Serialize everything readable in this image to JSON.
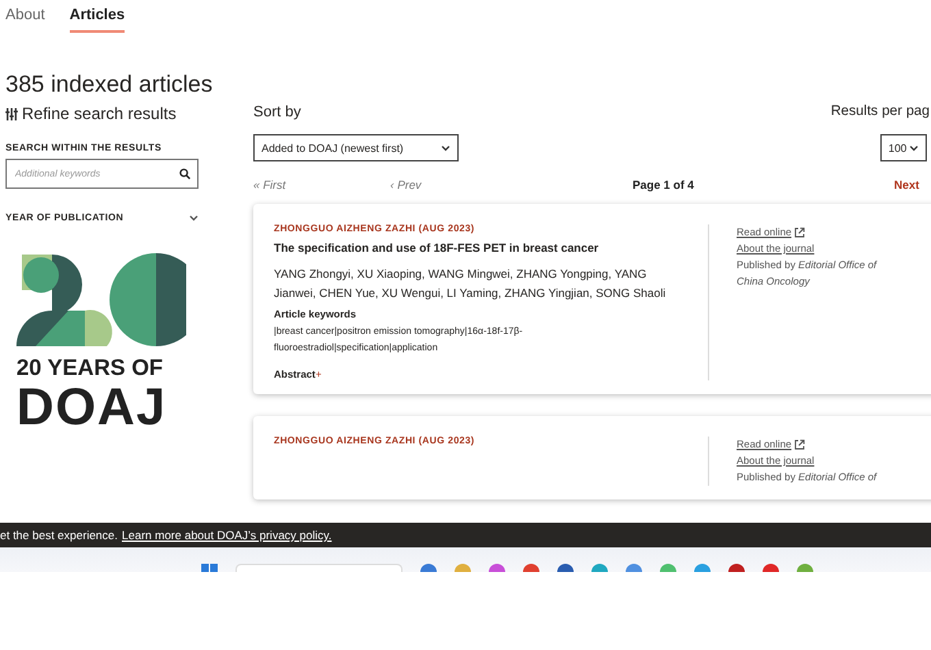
{
  "tabs": [
    {
      "label": "About",
      "selected": false
    },
    {
      "label": "Articles",
      "selected": true
    }
  ],
  "heading": "385 indexed articles",
  "refine": "Refine search results",
  "search": {
    "label": "SEARCH WITHIN THE RESULTS",
    "placeholder": "Additional keywords"
  },
  "facets": [
    {
      "label": "YEAR OF PUBLICATION",
      "expanded": false
    }
  ],
  "logo": {
    "line1": "20 YEARS OF",
    "line2": "DOAJ"
  },
  "sort": {
    "label": "Sort by",
    "value": "Added to DOAJ (newest first)"
  },
  "per_page": {
    "label": "Results per pag",
    "value": "100"
  },
  "pagination": {
    "first": "« First",
    "prev": "‹ Prev",
    "page": "Page 1 of 4",
    "next": "Next"
  },
  "articles": [
    {
      "source": "ZHONGGUO AIZHENG ZAZHI (AUG 2023)",
      "title": "The specification and use of 18F-FES PET in breast cancer",
      "authors": "YANG Zhongyi, XU Xiaoping, WANG Mingwei, ZHANG Yongping, YANG Jianwei, CHEN Yue, XU Wengui, LI Yaming, ZHANG Yingjian, SONG Shaoli",
      "keywords_label": "Article keywords",
      "keywords": "|breast cancer|positron emission tomography|16α-18f-17β-fluoroestradiol|specification|application",
      "abstract": "Abstract",
      "abstract_toggle": "+",
      "read_online": "Read online",
      "about_journal": "About the journal",
      "publisher": "Published by *Editorial Office of China Oncology*"
    },
    {
      "source": "ZHONGGUO AIZHENG ZAZHI (AUG 2023)",
      "read_online": "Read online",
      "about_journal": "About the journal",
      "publisher": "Published by *Editorial Office of*"
    }
  ],
  "cookie": {
    "text": "et the best experience.",
    "link": "Learn more about DOAJ’s privacy policy."
  }
}
